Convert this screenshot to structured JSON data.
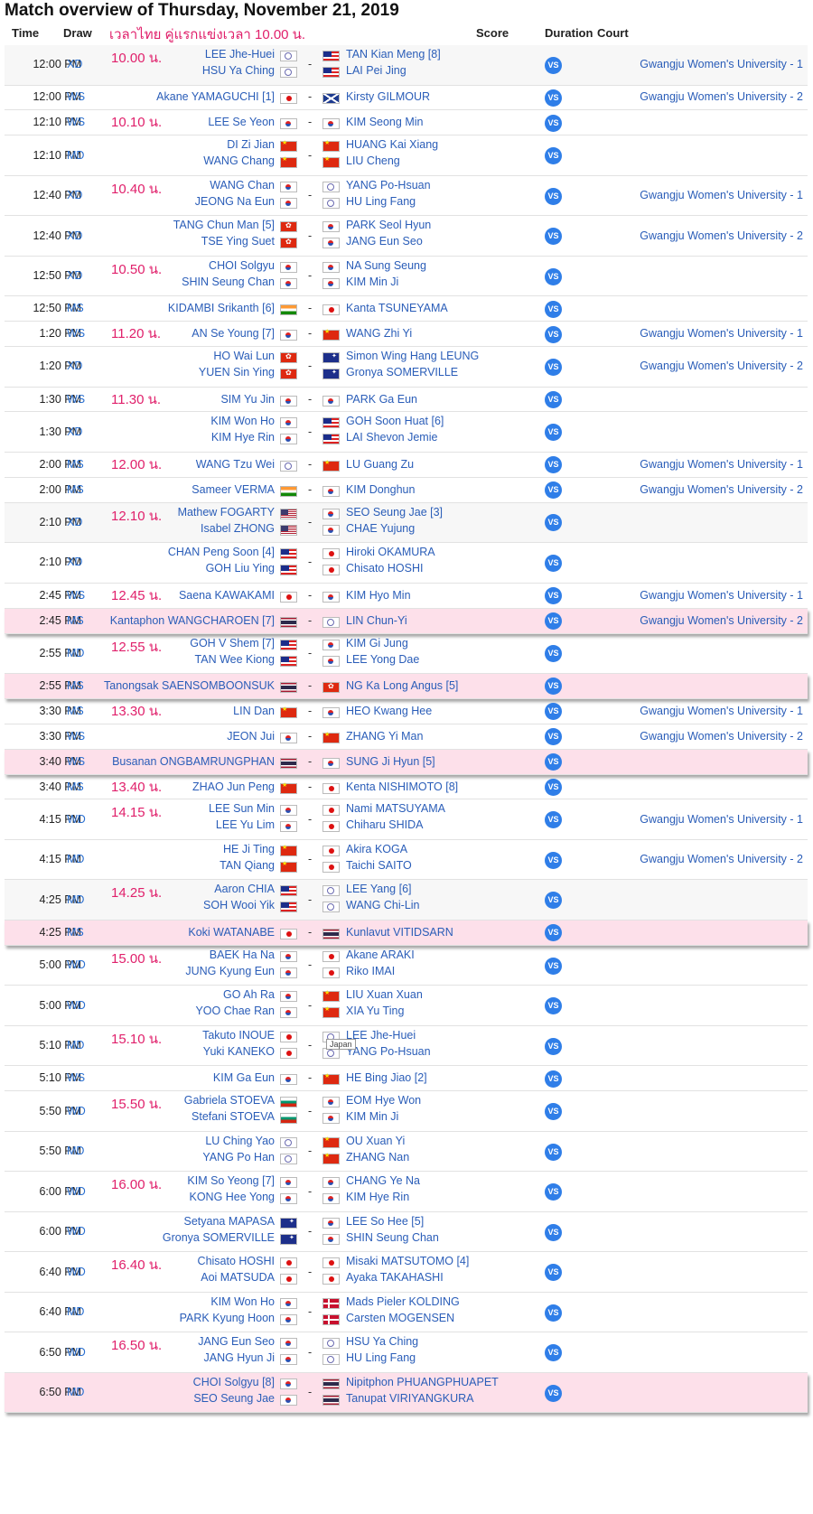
{
  "title": "Match overview of Thursday, November 21, 2019",
  "header": {
    "time": "Time",
    "draw": "Draw",
    "thai_note": "เวลาไทย คู่แรกแข่งเวลา 10.00 น.",
    "score": "Score",
    "duration": "Duration",
    "court": "Court"
  },
  "vs_label": "VS",
  "tooltip": "Japan",
  "colors": {
    "link": "#2a5db8",
    "thai_note": "#e0206b",
    "highlight_row": "#fde0ea",
    "vs_badge": "#2f7ee8"
  },
  "matches": [
    {
      "time": "12:00 PM",
      "draw": "XD",
      "thai": "10.00 น.",
      "left": [
        [
          "LEE Jhe-Huei",
          "tw"
        ],
        [
          "HSU Ya Ching",
          "tw"
        ]
      ],
      "right": [
        [
          "TAN Kian Meng [8]",
          "my"
        ],
        [
          "LAI Pei Jing",
          "my"
        ]
      ],
      "court": "Gwangju Women's University - 1",
      "style": "alt"
    },
    {
      "time": "12:00 PM",
      "draw": "WS",
      "thai": "",
      "left": [
        [
          "Akane YAMAGUCHI [1]",
          "jp"
        ]
      ],
      "right": [
        [
          "Kirsty GILMOUR",
          "sc"
        ]
      ],
      "court": "Gwangju Women's University - 2",
      "style": ""
    },
    {
      "time": "12:10 PM",
      "draw": "WS",
      "thai": "10.10 น.",
      "left": [
        [
          "LEE Se Yeon",
          "kr"
        ]
      ],
      "right": [
        [
          "KIM Seong Min",
          "kr"
        ]
      ],
      "court": "",
      "style": ""
    },
    {
      "time": "12:10 PM",
      "draw": "MD",
      "thai": "",
      "left": [
        [
          "DI Zi Jian",
          "cn"
        ],
        [
          "WANG Chang",
          "cn"
        ]
      ],
      "right": [
        [
          "HUANG Kai Xiang",
          "cn"
        ],
        [
          "LIU Cheng",
          "cn"
        ]
      ],
      "court": "",
      "style": ""
    },
    {
      "time": "12:40 PM",
      "draw": "XD",
      "thai": "10.40 น.",
      "left": [
        [
          "WANG Chan",
          "kr"
        ],
        [
          "JEONG Na Eun",
          "kr"
        ]
      ],
      "right": [
        [
          "YANG Po-Hsuan",
          "tw"
        ],
        [
          "HU Ling Fang",
          "tw"
        ]
      ],
      "court": "Gwangju Women's University - 1",
      "style": ""
    },
    {
      "time": "12:40 PM",
      "draw": "XD",
      "thai": "",
      "left": [
        [
          "TANG Chun Man [5]",
          "hk"
        ],
        [
          "TSE Ying Suet",
          "hk"
        ]
      ],
      "right": [
        [
          "PARK Seol Hyun",
          "kr"
        ],
        [
          "JANG Eun Seo",
          "kr"
        ]
      ],
      "court": "Gwangju Women's University - 2",
      "style": ""
    },
    {
      "time": "12:50 PM",
      "draw": "XD",
      "thai": "10.50 น.",
      "left": [
        [
          "CHOI Solgyu",
          "kr"
        ],
        [
          "SHIN Seung Chan",
          "kr"
        ]
      ],
      "right": [
        [
          "NA Sung Seung",
          "kr"
        ],
        [
          "KIM Min Ji",
          "kr"
        ]
      ],
      "court": "",
      "style": ""
    },
    {
      "time": "12:50 PM",
      "draw": "MS",
      "thai": "",
      "left": [
        [
          "KIDAMBI Srikanth [6]",
          "inf"
        ]
      ],
      "right": [
        [
          "Kanta TSUNEYAMA",
          "jp"
        ]
      ],
      "court": "",
      "style": ""
    },
    {
      "time": "1:20 PM",
      "draw": "WS",
      "thai": "11.20 น.",
      "left": [
        [
          "AN Se Young [7]",
          "kr"
        ]
      ],
      "right": [
        [
          "WANG Zhi Yi",
          "cn"
        ]
      ],
      "court": "Gwangju Women's University - 1",
      "style": ""
    },
    {
      "time": "1:20 PM",
      "draw": "XD",
      "thai": "",
      "left": [
        [
          "HO Wai Lun",
          "hk"
        ],
        [
          "YUEN Sin Ying",
          "hk"
        ]
      ],
      "right": [
        [
          "Simon Wing Hang LEUNG",
          "au"
        ],
        [
          "Gronya SOMERVILLE",
          "au"
        ]
      ],
      "court": "Gwangju Women's University - 2",
      "style": ""
    },
    {
      "time": "1:30 PM",
      "draw": "WS",
      "thai": "11.30 น.",
      "left": [
        [
          "SIM Yu Jin",
          "kr"
        ]
      ],
      "right": [
        [
          "PARK Ga Eun",
          "kr"
        ]
      ],
      "court": "",
      "style": ""
    },
    {
      "time": "1:30 PM",
      "draw": "XD",
      "thai": "",
      "left": [
        [
          "KIM Won Ho",
          "kr"
        ],
        [
          "KIM Hye Rin",
          "kr"
        ]
      ],
      "right": [
        [
          "GOH Soon Huat [6]",
          "my"
        ],
        [
          "LAI Shevon Jemie",
          "my"
        ]
      ],
      "court": "",
      "style": ""
    },
    {
      "time": "2:00 PM",
      "draw": "MS",
      "thai": "12.00 น.",
      "left": [
        [
          "WANG Tzu Wei",
          "tw"
        ]
      ],
      "right": [
        [
          "LU Guang Zu",
          "cn"
        ]
      ],
      "court": "Gwangju Women's University - 1",
      "style": ""
    },
    {
      "time": "2:00 PM",
      "draw": "MS",
      "thai": "",
      "left": [
        [
          "Sameer VERMA",
          "inf"
        ]
      ],
      "right": [
        [
          "KIM Donghun",
          "kr"
        ]
      ],
      "court": "Gwangju Women's University - 2",
      "style": ""
    },
    {
      "time": "2:10 PM",
      "draw": "XD",
      "thai": "12.10 น.",
      "left": [
        [
          "Mathew FOGARTY",
          "us"
        ],
        [
          "Isabel ZHONG",
          "us"
        ]
      ],
      "right": [
        [
          "SEO Seung Jae [3]",
          "kr"
        ],
        [
          "CHAE Yujung",
          "kr"
        ]
      ],
      "court": "",
      "style": "alt"
    },
    {
      "time": "2:10 PM",
      "draw": "XD",
      "thai": "",
      "left": [
        [
          "CHAN Peng Soon [4]",
          "my"
        ],
        [
          "GOH Liu Ying",
          "my"
        ]
      ],
      "right": [
        [
          "Hiroki OKAMURA",
          "jp"
        ],
        [
          "Chisato HOSHI",
          "jp"
        ]
      ],
      "court": "",
      "style": ""
    },
    {
      "time": "2:45 PM",
      "draw": "WS",
      "thai": "12.45 น.",
      "left": [
        [
          "Saena KAWAKAMI",
          "jp"
        ]
      ],
      "right": [
        [
          "KIM Hyo Min",
          "kr"
        ]
      ],
      "court": "Gwangju Women's University - 1",
      "style": ""
    },
    {
      "time": "2:45 PM",
      "draw": "MS",
      "thai": "",
      "left": [
        [
          "Kantaphon WANGCHAROEN [7]",
          "th"
        ]
      ],
      "right": [
        [
          "LIN Chun-Yi",
          "tw"
        ]
      ],
      "court": "Gwangju Women's University - 2",
      "style": "hl"
    },
    {
      "time": "2:55 PM",
      "draw": "MD",
      "thai": "12.55 น.",
      "left": [
        [
          "GOH V Shem [7]",
          "my"
        ],
        [
          "TAN Wee Kiong",
          "my"
        ]
      ],
      "right": [
        [
          "KIM Gi Jung",
          "kr"
        ],
        [
          "LEE Yong Dae",
          "kr"
        ]
      ],
      "court": "",
      "style": ""
    },
    {
      "time": "2:55 PM",
      "draw": "MS",
      "thai": "",
      "left": [
        [
          "Tanongsak SAENSOMBOONSUK",
          "th"
        ]
      ],
      "right": [
        [
          "NG Ka Long Angus [5]",
          "hk"
        ]
      ],
      "court": "",
      "style": "hl"
    },
    {
      "time": "3:30 PM",
      "draw": "MS",
      "thai": "13.30 น.",
      "left": [
        [
          "LIN Dan",
          "cn"
        ]
      ],
      "right": [
        [
          "HEO Kwang Hee",
          "kr"
        ]
      ],
      "court": "Gwangju Women's University - 1",
      "style": ""
    },
    {
      "time": "3:30 PM",
      "draw": "WS",
      "thai": "",
      "left": [
        [
          "JEON Jui",
          "kr"
        ]
      ],
      "right": [
        [
          "ZHANG Yi Man",
          "cn"
        ]
      ],
      "court": "Gwangju Women's University - 2",
      "style": ""
    },
    {
      "time": "3:40 PM",
      "draw": "WS",
      "thai": "",
      "left": [
        [
          "Busanan ONGBAMRUNGPHAN",
          "th"
        ]
      ],
      "right": [
        [
          "SUNG Ji Hyun [5]",
          "kr"
        ]
      ],
      "court": "",
      "style": "hl"
    },
    {
      "time": "3:40 PM",
      "draw": "MS",
      "thai": "13.40 น.",
      "left": [
        [
          "ZHAO Jun Peng",
          "cn"
        ]
      ],
      "right": [
        [
          "Kenta NISHIMOTO [8]",
          "jp"
        ]
      ],
      "court": "",
      "style": ""
    },
    {
      "time": "4:15 PM",
      "draw": "WD",
      "thai": "14.15 น.",
      "left": [
        [
          "LEE Sun Min",
          "kr"
        ],
        [
          "LEE Yu Lim",
          "kr"
        ]
      ],
      "right": [
        [
          "Nami MATSUYAMA",
          "jp"
        ],
        [
          "Chiharu SHIDA",
          "jp"
        ]
      ],
      "court": "Gwangju Women's University - 1",
      "style": ""
    },
    {
      "time": "4:15 PM",
      "draw": "MD",
      "thai": "",
      "left": [
        [
          "HE Ji Ting",
          "cn"
        ],
        [
          "TAN Qiang",
          "cn"
        ]
      ],
      "right": [
        [
          "Akira KOGA",
          "jp"
        ],
        [
          "Taichi SAITO",
          "jp"
        ]
      ],
      "court": "Gwangju Women's University - 2",
      "style": ""
    },
    {
      "time": "4:25 PM",
      "draw": "MD",
      "thai": "14.25 น.",
      "left": [
        [
          "Aaron CHIA",
          "my"
        ],
        [
          "SOH Wooi Yik",
          "my"
        ]
      ],
      "right": [
        [
          "LEE Yang [6]",
          "tw"
        ],
        [
          "WANG Chi-Lin",
          "tw"
        ]
      ],
      "court": "",
      "style": "alt"
    },
    {
      "time": "4:25 PM",
      "draw": "MS",
      "thai": "",
      "left": [
        [
          "Koki WATANABE",
          "jp"
        ]
      ],
      "right": [
        [
          "Kunlavut VITIDSARN",
          "th"
        ]
      ],
      "court": "",
      "style": "hl"
    },
    {
      "time": "5:00 PM",
      "draw": "WD",
      "thai": "15.00 น.",
      "left": [
        [
          "BAEK Ha Na",
          "kr"
        ],
        [
          "JUNG Kyung Eun",
          "kr"
        ]
      ],
      "right": [
        [
          "Akane ARAKI",
          "jp"
        ],
        [
          "Riko IMAI",
          "jp"
        ]
      ],
      "court": "",
      "style": ""
    },
    {
      "time": "5:00 PM",
      "draw": "WD",
      "thai": "",
      "left": [
        [
          "GO Ah Ra",
          "kr"
        ],
        [
          "YOO Chae Ran",
          "kr"
        ]
      ],
      "right": [
        [
          "LIU Xuan Xuan",
          "cn"
        ],
        [
          "XIA Yu Ting",
          "cn"
        ]
      ],
      "court": "",
      "style": ""
    },
    {
      "time": "5:10 PM",
      "draw": "MD",
      "thai": "15.10 น.",
      "left": [
        [
          "Takuto INOUE",
          "jp"
        ],
        [
          "Yuki KANEKO",
          "jp"
        ]
      ],
      "right": [
        [
          "LEE Jhe-Huei",
          "tw"
        ],
        [
          "YANG Po-Hsuan",
          "tw"
        ]
      ],
      "court": "",
      "style": ""
    },
    {
      "time": "5:10 PM",
      "draw": "WS",
      "thai": "",
      "left": [
        [
          "KIM Ga Eun",
          "kr"
        ]
      ],
      "right": [
        [
          "HE Bing Jiao [2]",
          "cn"
        ]
      ],
      "court": "",
      "style": ""
    },
    {
      "time": "5:50 PM",
      "draw": "WD",
      "thai": "15.50 น.",
      "left": [
        [
          "Gabriela STOEVA",
          "bg"
        ],
        [
          "Stefani STOEVA",
          "bg"
        ]
      ],
      "right": [
        [
          "EOM Hye Won",
          "kr"
        ],
        [
          "KIM Min Ji",
          "kr"
        ]
      ],
      "court": "",
      "style": ""
    },
    {
      "time": "5:50 PM",
      "draw": "MD",
      "thai": "",
      "left": [
        [
          "LU Ching Yao",
          "tw"
        ],
        [
          "YANG Po Han",
          "tw"
        ]
      ],
      "right": [
        [
          "OU Xuan Yi",
          "cn"
        ],
        [
          "ZHANG Nan",
          "cn"
        ]
      ],
      "court": "",
      "style": ""
    },
    {
      "time": "6:00 PM",
      "draw": "WD",
      "thai": "16.00 น.",
      "left": [
        [
          "KIM So Yeong [7]",
          "kr"
        ],
        [
          "KONG Hee Yong",
          "kr"
        ]
      ],
      "right": [
        [
          "CHANG Ye Na",
          "kr"
        ],
        [
          "KIM Hye Rin",
          "kr"
        ]
      ],
      "court": "",
      "style": ""
    },
    {
      "time": "6:00 PM",
      "draw": "WD",
      "thai": "",
      "left": [
        [
          "Setyana MAPASA",
          "au"
        ],
        [
          "Gronya SOMERVILLE",
          "au"
        ]
      ],
      "right": [
        [
          "LEE So Hee [5]",
          "kr"
        ],
        [
          "SHIN Seung Chan",
          "kr"
        ]
      ],
      "court": "",
      "style": ""
    },
    {
      "time": "6:40 PM",
      "draw": "WD",
      "thai": "16.40 น.",
      "left": [
        [
          "Chisato HOSHI",
          "jp"
        ],
        [
          "Aoi MATSUDA",
          "jp"
        ]
      ],
      "right": [
        [
          "Misaki MATSUTOMO [4]",
          "jp"
        ],
        [
          "Ayaka TAKAHASHI",
          "jp"
        ]
      ],
      "court": "",
      "style": ""
    },
    {
      "time": "6:40 PM",
      "draw": "MD",
      "thai": "",
      "left": [
        [
          "KIM Won Ho",
          "kr"
        ],
        [
          "PARK Kyung Hoon",
          "kr"
        ]
      ],
      "right": [
        [
          "Mads Pieler KOLDING",
          "dk"
        ],
        [
          "Carsten MOGENSEN",
          "dk"
        ]
      ],
      "court": "",
      "style": ""
    },
    {
      "time": "6:50 PM",
      "draw": "WD",
      "thai": "16.50 น.",
      "left": [
        [
          "JANG Eun Seo",
          "kr"
        ],
        [
          "JANG Hyun Ji",
          "kr"
        ]
      ],
      "right": [
        [
          "HSU Ya Ching",
          "tw"
        ],
        [
          "HU Ling Fang",
          "tw"
        ]
      ],
      "court": "",
      "style": ""
    },
    {
      "time": "6:50 PM",
      "draw": "MD",
      "thai": "",
      "left": [
        [
          "CHOI Solgyu [8]",
          "kr"
        ],
        [
          "SEO Seung Jae",
          "kr"
        ]
      ],
      "right": [
        [
          "Nipitphon PHUANGPHUAPET",
          "th"
        ],
        [
          "Tanupat VIRIYANGKURA",
          "th"
        ]
      ],
      "court": "",
      "style": "hl"
    }
  ]
}
